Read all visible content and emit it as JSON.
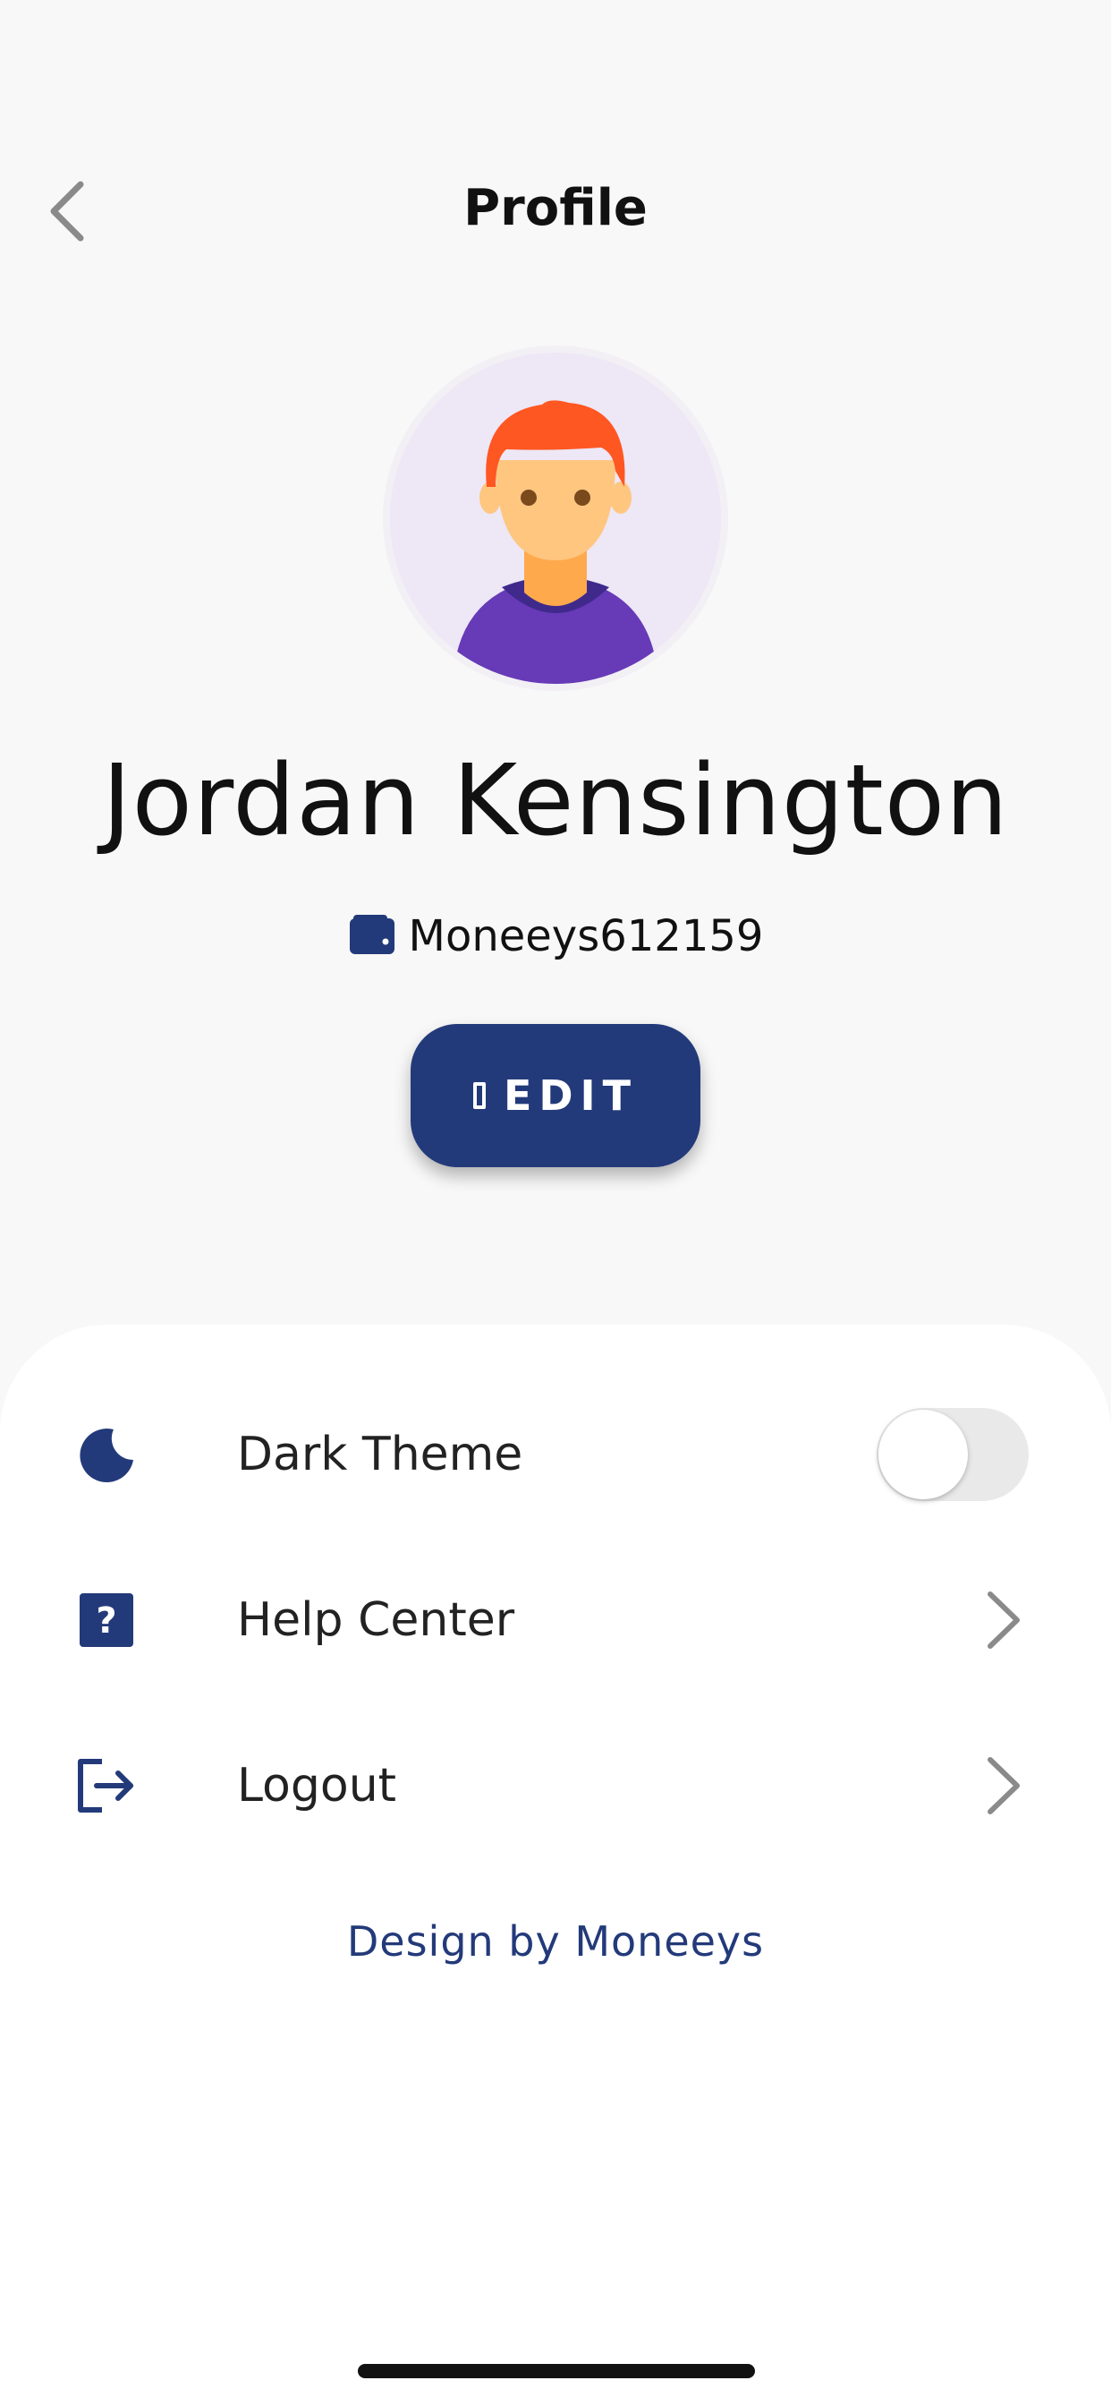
{
  "header": {
    "title": "Profile",
    "back_icon": "chevron-left-icon"
  },
  "profile": {
    "avatar_icon": "user-avatar",
    "name": "Jordan Kensington",
    "wallet_icon": "wallet-icon",
    "wallet_id": "Moneeys612159",
    "edit_label": "EDIT"
  },
  "settings": {
    "items": [
      {
        "label": "Dark Theme",
        "icon": "moon-icon",
        "control": "toggle",
        "enabled": false
      },
      {
        "label": "Help Center",
        "icon": "help-icon",
        "control": "chevron"
      },
      {
        "label": "Logout",
        "icon": "logout-icon",
        "control": "chevron"
      }
    ]
  },
  "footer": {
    "credit": "Design by Moneeys"
  },
  "colors": {
    "accent": "#233a7a",
    "background": "#f8f8f8",
    "sheet": "#ffffff",
    "toggle_off": "#e9e9e9"
  }
}
